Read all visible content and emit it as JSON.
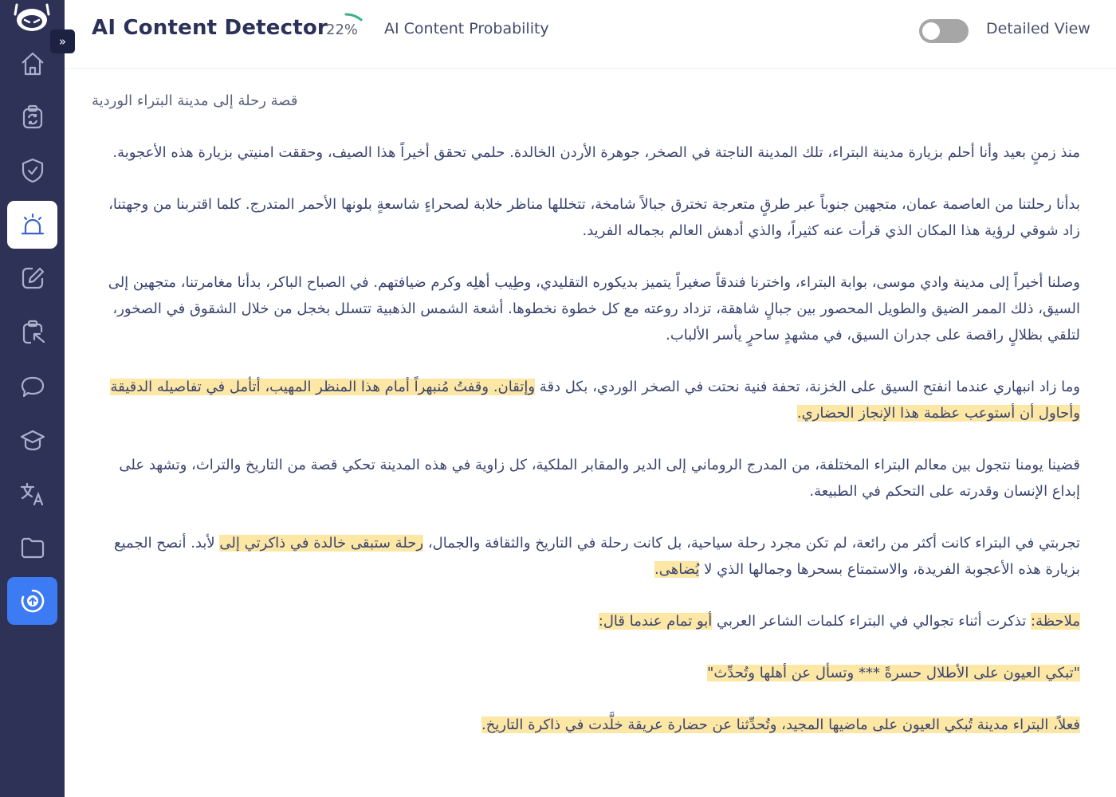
{
  "app": {
    "title": "AI Content Detector",
    "probability_value": "22%",
    "probability_fraction": 0.22,
    "probability_label": "AI Content Probability",
    "detailed_view_label": "Detailed View",
    "detailed_view_on": false,
    "expand_icon": "»"
  },
  "colors": {
    "sidebar_bg": "#2d3256",
    "accent_blue": "#3d7bf5",
    "gauge_green": "#3bb08f",
    "highlight_yellow": "#fde7a4",
    "title_color": "#2b3158"
  },
  "sidebar": {
    "items": [
      {
        "icon": "home-icon",
        "label": "Home"
      },
      {
        "icon": "clipboard-refresh-icon",
        "label": "Paraphraser"
      },
      {
        "icon": "shield-check-icon",
        "label": "Plagiarism Checker"
      },
      {
        "icon": "alarm-light-icon",
        "label": "AI Content Detector",
        "active": true
      },
      {
        "icon": "edit-icon",
        "label": "Writer"
      },
      {
        "icon": "clipboard-cursor-icon",
        "label": "Summarizer"
      },
      {
        "icon": "chat-bubble-icon",
        "label": "Chat"
      },
      {
        "icon": "graduation-cap-icon",
        "label": "Learning"
      },
      {
        "icon": "translate-icon",
        "label": "Translator"
      },
      {
        "icon": "folder-icon",
        "label": "Files"
      },
      {
        "icon": "upgrade-icon",
        "label": "Upgrade"
      }
    ]
  },
  "document": {
    "title": "قصة رحلة إلى مدينة البتراء الوردية",
    "paragraphs": [
      {
        "segments": [
          {
            "text": "منذ زمنٍ بعيد وأنا أحلم بزيارة مدينة البتراء، تلك المدينة الناجتة في الصخر، جوهرة الأردن الخالدة. حلمي تحقق أخيراً هذا الصيف، وحققت امنيتي بزيارة هذه الأعجوبة.",
            "highlight": false
          }
        ]
      },
      {
        "segments": [
          {
            "text": "بدأنا رحلتنا من العاصمة عمان، متجهين جنوباً عبر طرقٍ متعرجة تخترق جبالاً شامخة، تتخللها مناظر خلابة لصحراءٍ شاسعةٍ بلونها الأحمر المتدرج. كلما اقتربنا من وجهتنا، زاد شوقي لرؤية هذا المكان الذي قرأت عنه كثيراً، والذي أدهش العالم بجماله الفريد.",
            "highlight": false
          }
        ]
      },
      {
        "segments": [
          {
            "text": "وصلنا أخيراً إلى مدينة وادي موسى، بوابة البتراء، واخترنا فندقاً صغيراً يتميز بديكوره التقليدي، وطِيب أهلِه وكرم ضيافتهم. في الصباح الباكر، بدأنا مغامرتنا، متجهين إلى السيق، ذلك الممر الضيق والطويل المحصور بين جبالٍ شاهقة، تزداد روعته مع كل خطوة نخطوها. أشعة الشمس الذهبية تتسلل بخجل من خلال الشقوق في الصخور، لتلقي بظلالٍ راقصة على جدران السيق، في مشهدٍ ساحرٍ يأسر الألباب.",
            "highlight": false
          }
        ]
      },
      {
        "segments": [
          {
            "text": "وما زاد انبهاري عندما انفتح السيق على الخزنة، تحفة فنية نحتت في الصخر الوردي، بكل دقة ",
            "highlight": false
          },
          {
            "text": "وإتقان. وقفتُ مُنبهراً أمام هذا المنظر المهيب، أتأمل في تفاصيله الدقيقة وأحاول أن أستوعب عظمة هذا الإنجاز الحضاري.",
            "highlight": true
          }
        ]
      },
      {
        "segments": [
          {
            "text": "قضينا يومنا نتجول بين معالم البتراء المختلفة، من المدرج الروماني إلى الدير والمقابر الملكية، كل زاوية في هذه المدينة تحكي قصة من التاريخ والتراث، وتشهد على إبداع الإنسان وقدرته على التحكم في الطبيعة.",
            "highlight": false
          }
        ]
      },
      {
        "segments": [
          {
            "text": "تجربتي في البتراء كانت أكثر من رائعة، لم تكن مجرد رحلة سياحية، بل كانت رحلة في التاريخ والثقافة والجمال، ",
            "highlight": false
          },
          {
            "text": "رحلة ستبقى خالدة في ذاكرتي إلى",
            "highlight": true
          },
          {
            "text": " لأبد. أنصح الجميع بزيارة هذه الأعجوبة الفريدة، والاستمتاع بسحرها وجمالها الذي لا ",
            "highlight": false
          },
          {
            "text": "يُضاهى.",
            "highlight": true
          }
        ]
      },
      {
        "segments": [
          {
            "text": "ملاحظة:",
            "highlight": true
          },
          {
            "text": " تذكرت أثناء تجوالي في البتراء كلمات الشاعر العربي ",
            "highlight": false
          },
          {
            "text": "أبو تمام عندما قال:",
            "highlight": true
          }
        ]
      },
      {
        "segments": [
          {
            "text": "\"تبكي العيون على الأطلال حسرةً *** وتسأل عن أهلها وتُحدِّث\"",
            "highlight": true
          }
        ]
      },
      {
        "segments": [
          {
            "text": "فعلاً، البتراء مدينة تُبكي العيون على ماضيها المجيد، وتُحدِّثنا عن حضارة عريقة خلَّدت في ذاكرة التاريخ.",
            "highlight": true
          }
        ]
      }
    ]
  }
}
